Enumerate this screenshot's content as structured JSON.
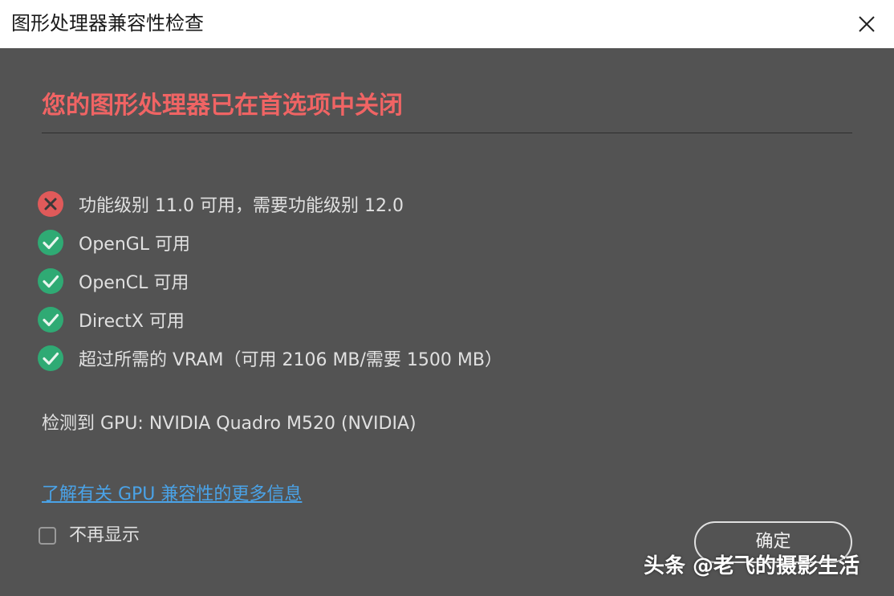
{
  "window": {
    "title": "图形处理器兼容性检查",
    "close_icon": "close-icon"
  },
  "heading": "您的图形处理器已在首选项中关闭",
  "checks": [
    {
      "status": "fail",
      "icon": "error-x-icon",
      "text": "功能级别 11.0 可用，需要功能级别 12.0"
    },
    {
      "status": "pass",
      "icon": "check-icon",
      "text": "OpenGL 可用"
    },
    {
      "status": "pass",
      "icon": "check-icon",
      "text": "OpenCL 可用"
    },
    {
      "status": "pass",
      "icon": "check-icon",
      "text": "DirectX 可用"
    },
    {
      "status": "pass",
      "icon": "check-icon",
      "text": "超过所需的 VRAM（可用 2106 MB/需要 1500 MB）"
    }
  ],
  "gpu_detected": "检测到 GPU: NVIDIA Quadro M520 (NVIDIA)",
  "more_info_link": "了解有关 GPU 兼容性的更多信息",
  "dont_show_again": {
    "label": "不再显示",
    "checked": false
  },
  "ok_button": "确定",
  "watermark": "头条 @老飞的摄影生活",
  "colors": {
    "background": "#535353",
    "titlebar": "#ffffff",
    "heading": "#f06464",
    "pass": "#2faa74",
    "fail": "#e05a5a",
    "link": "#4aa3e8",
    "text": "#e0e0e0"
  }
}
